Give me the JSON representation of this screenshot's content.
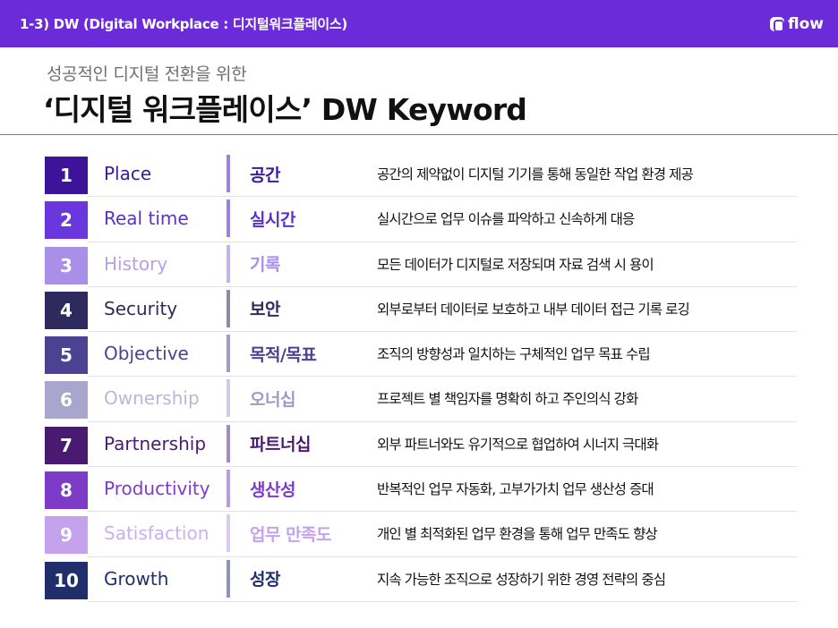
{
  "header": {
    "title": "1-3) DW (Digital Workplace : 디지털워크플레이스)",
    "logo_text": "flow",
    "logo_icon": "flow-logo-icon",
    "color": "#6c2bd9"
  },
  "subtitle": "성공적인 디지털 전환을 위한",
  "heading": "‘디지털 워크플레이스’ DW Keyword",
  "keywords": [
    {
      "num": "1",
      "eng": "Place",
      "kor": "공간",
      "desc": "공간의 제약없이 디지털 기기를 통해 동일한 작업 환경 제공",
      "box_color": "#3d1399",
      "eng_color": "#3a1c96",
      "kor_color": "#3a1c96",
      "bar_color": "#9b82e0"
    },
    {
      "num": "2",
      "eng": "Real time",
      "kor": "실시간",
      "desc": "실시간으로 업무 이슈를 파악하고 신속하게 대응",
      "box_color": "#6a36de",
      "eng_color": "#5a32c8",
      "kor_color": "#5a32c8",
      "bar_color": "#9b82e0"
    },
    {
      "num": "3",
      "eng": "History",
      "kor": "기록",
      "desc": "모든 데이터가 디지털로 저장되며 자료 검색 시 용이",
      "box_color": "#a98fe8",
      "eng_color": "#b3a2e6",
      "kor_color": "#a98fe8",
      "bar_color": "#c3b4ee"
    },
    {
      "num": "4",
      "eng": "Security",
      "kor": "보안",
      "desc": "외부로부터 데이터로 보호하고 내부 데이터 접근 기록 로깅",
      "box_color": "#2f2a5e",
      "eng_color": "#2f2a5e",
      "kor_color": "#2f2a5e",
      "bar_color": "#8d8aa6"
    },
    {
      "num": "5",
      "eng": "Objective",
      "kor": "목적/목표",
      "desc": "조직의 방향성과 일치하는 구체적인 업무 목표 수립",
      "box_color": "#4b4391",
      "eng_color": "#4b4391",
      "kor_color": "#4b4391",
      "bar_color": "#a09cc4"
    },
    {
      "num": "6",
      "eng": "Ownership",
      "kor": "오너십",
      "desc": "프로젝트 별 책임자를 명확히 하고 주인의식 강화",
      "box_color": "#a8a6cc",
      "eng_color": "#b9b7d6",
      "kor_color": "#9d9ac6",
      "bar_color": "#cfcde3"
    },
    {
      "num": "7",
      "eng": "Partnership",
      "kor": "파트너십",
      "desc": "외부 파트너와도 유기적으로 협업하여 시너지 극대화",
      "box_color": "#4a1a72",
      "eng_color": "#4a1a72",
      "kor_color": "#4a1a72",
      "bar_color": "#a38bbd"
    },
    {
      "num": "8",
      "eng": "Productivity",
      "kor": "생산성",
      "desc": "반복적인 업무 자동화, 고부가가치 업무 생산성 증대",
      "box_color": "#7d3bc8",
      "eng_color": "#7d3bc8",
      "kor_color": "#7d3bc8",
      "bar_color": "#b99ce0"
    },
    {
      "num": "9",
      "eng": "Satisfaction",
      "kor": "업무 만족도",
      "desc": "개인 별 최적화된 업무 환경을 통해 업무 만족도 향상",
      "box_color": "#c5a3ec",
      "eng_color": "#c9b1ec",
      "kor_color": "#c5a3ec",
      "bar_color": "#dccaf3"
    },
    {
      "num": "10",
      "eng": "Growth",
      "kor": "성장",
      "desc": "지속 가능한 조직으로 성장하기 위한 경영 전략의 중심",
      "box_color": "#1f2f6b",
      "eng_color": "#1f2f6b",
      "kor_color": "#1f2f6b",
      "bar_color": "#8d95b8"
    }
  ]
}
